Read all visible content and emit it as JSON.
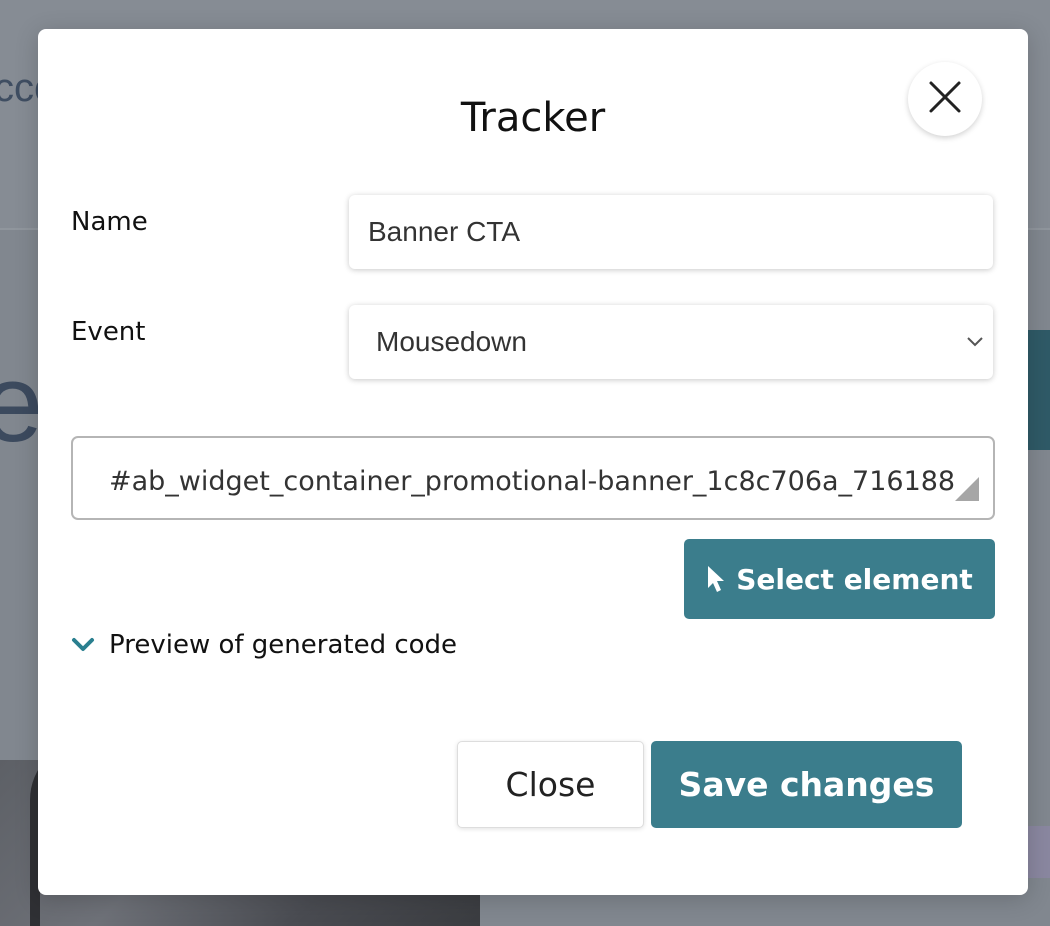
{
  "background": {
    "partial_text_top": "cce",
    "partial_text_big": "e"
  },
  "modal": {
    "title": "Tracker",
    "close_icon": "close-icon",
    "name": {
      "label": "Name",
      "value": "Banner CTA"
    },
    "event": {
      "label": "Event",
      "selected": "Mousedown",
      "icon": "chevron-down-icon"
    },
    "selector": {
      "value": "#ab_widget_container_promotional-banner_1c8c706a_716188"
    },
    "select_element": {
      "label": "Select element",
      "icon": "cursor-pointer-icon"
    },
    "preview": {
      "label": "Preview of generated code",
      "icon": "chevron-down-icon",
      "icon_color": "#2a7f8f"
    },
    "footer": {
      "close_label": "Close",
      "save_label": "Save changes"
    },
    "colors": {
      "accent": "#3b7d8c",
      "overlay": "#81878f"
    }
  }
}
